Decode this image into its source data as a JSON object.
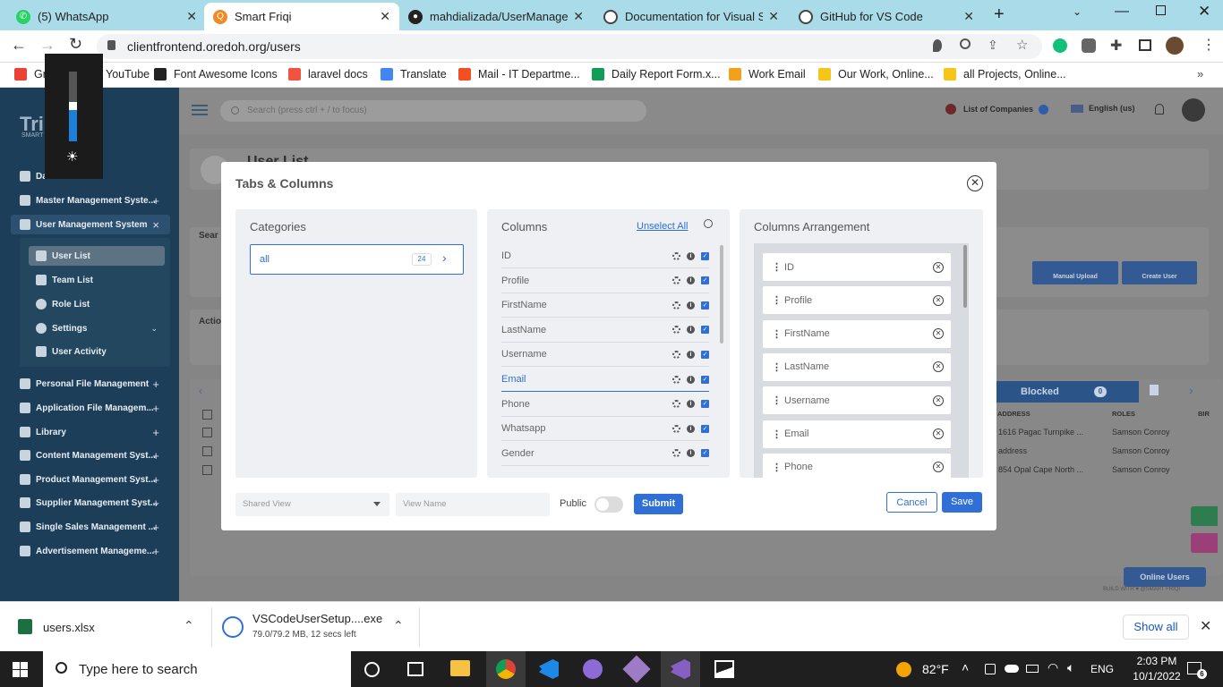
{
  "browser": {
    "tabs": [
      {
        "title": "(5) WhatsApp",
        "icon": "whatsapp-icon",
        "color": "#25d366"
      },
      {
        "title": "Smart Friqi",
        "icon": "smart-friqi-icon",
        "color": "#f08a24"
      },
      {
        "title": "mahdializada/UserManagem",
        "icon": "github-icon",
        "color": "#222222"
      },
      {
        "title": "Documentation for Visual St",
        "icon": "globe-icon",
        "color": "#444444"
      },
      {
        "title": "GitHub for VS Code",
        "icon": "globe-icon",
        "color": "#444444"
      }
    ],
    "url": "clientfrontend.oredoh.org/users",
    "bookmarks": [
      {
        "label": "Gmail",
        "color": "#ea4335"
      },
      {
        "label": "YouTube",
        "color": "#ff0000"
      },
      {
        "label": "Font Awesome Icons",
        "color": "#222222"
      },
      {
        "label": "laravel docs",
        "color": "#f05340"
      },
      {
        "label": "Translate",
        "color": "#4285f4"
      },
      {
        "label": "Mail - IT Departme...",
        "color": "#f25022"
      },
      {
        "label": "Daily Report Form.x...",
        "color": "#0f9d58"
      },
      {
        "label": "Work Email",
        "color": "#f4a01c"
      },
      {
        "label": "Our Work, Online...",
        "color": "#f5c518"
      },
      {
        "label": "all Projects, Online...",
        "color": "#f5c518"
      }
    ]
  },
  "app": {
    "logo": "SMART",
    "search_placeholder": "Search (press ctrl + / to focus)",
    "company_label": "List of Companies",
    "language": "English (us)",
    "page_title": "User List",
    "sidebar": {
      "items": [
        {
          "label": "Dashboard",
          "toggle": ""
        },
        {
          "label": "Master Management Syste...",
          "toggle": "+"
        },
        {
          "label": "User Management System",
          "toggle": "×"
        },
        {
          "label": "Personal File Management",
          "toggle": "+"
        },
        {
          "label": "Application File Managem...",
          "toggle": "+"
        },
        {
          "label": "Library",
          "toggle": "+"
        },
        {
          "label": "Content Management Syst...",
          "toggle": "+"
        },
        {
          "label": "Product Management Syst...",
          "toggle": "+"
        },
        {
          "label": "Supplier Management Syst...",
          "toggle": "+"
        },
        {
          "label": "Single Sales Management ...",
          "toggle": "+"
        },
        {
          "label": "Advertisement Manageme...",
          "toggle": "+"
        }
      ],
      "subitems": [
        "User List",
        "Team List",
        "Role List",
        "Settings",
        "User Activity"
      ]
    },
    "background": {
      "search_label": "Sear",
      "actions_label": "Actio",
      "manual_upload": "Manual Upload",
      "create_user": "Create User",
      "blocked_tab": "Blocked",
      "blocked_count": "0",
      "columns": [
        "ADDRESS",
        "ROLES",
        "BIR"
      ],
      "rows": [
        [
          "1616 Pagac Turnpike ...",
          "Samson Conroy"
        ],
        [
          "address",
          "Samson Conroy"
        ],
        [
          "854 Opal Cape North ...",
          "Samson Conroy"
        ]
      ],
      "online_users": "Online Users",
      "footer": "BUILD WITH ♥ @SMART FRIQI"
    }
  },
  "modal": {
    "title": "Tabs & Columns",
    "categories": {
      "header": "Categories",
      "items": [
        {
          "label": "all",
          "count": "24"
        }
      ]
    },
    "columns": {
      "header": "Columns",
      "unselect_all": "Unselect All",
      "items": [
        "ID",
        "Profile",
        "FirstName",
        "LastName",
        "Username",
        "Email",
        "Phone",
        "Whatsapp",
        "Gender"
      ],
      "active": "Email"
    },
    "arrangement": {
      "header": "Columns Arrangement",
      "items": [
        "ID",
        "Profile",
        "FirstName",
        "LastName",
        "Username",
        "Email",
        "Phone"
      ]
    },
    "footer": {
      "shared_view_placeholder": "Shared View",
      "view_name_placeholder": "View Name",
      "public_label": "Public",
      "submit": "Submit",
      "cancel": "Cancel",
      "save": "Save"
    }
  },
  "downloads": [
    {
      "name": "users.xlsx",
      "status": ""
    },
    {
      "name": "VSCodeUserSetup....exe",
      "status": "79.0/79.2 MB, 12 secs left"
    }
  ],
  "downloads_show_all": "Show all",
  "taskbar": {
    "search_placeholder": "Type here to search",
    "weather": "82°F",
    "language": "ENG",
    "time": "2:03 PM",
    "date": "10/1/2022",
    "notifications": "6"
  },
  "overlay": {
    "brightness_level": 0.45
  }
}
